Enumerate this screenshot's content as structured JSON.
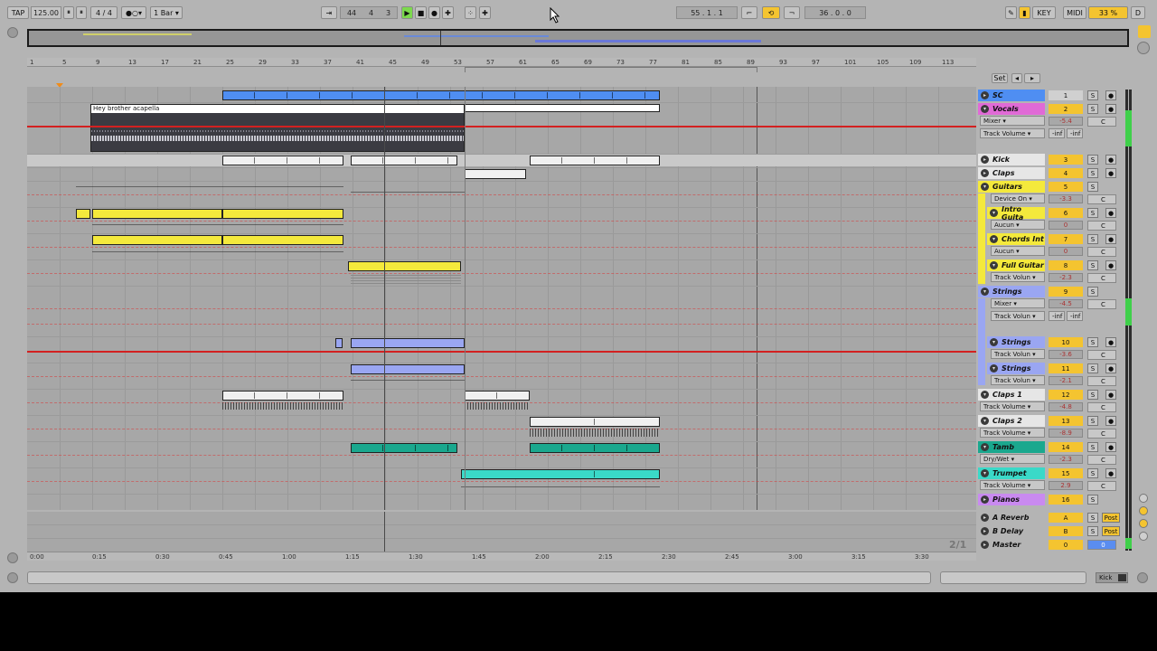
{
  "transport": {
    "tap": "TAP",
    "tempo": "125.00",
    "signature": "4 / 4",
    "quantize": "1 Bar",
    "arr_pos_bar": "44",
    "arr_pos_beat": "4",
    "arr_pos_sixteenth": "3",
    "loop_start": "55 . 1 . 1",
    "loop_length": "36 . 0 . 0",
    "key": "KEY",
    "midi": "MIDI",
    "cpu": "33 %",
    "d": "D"
  },
  "ruler": {
    "bars": [
      "1",
      "5",
      "9",
      "13",
      "17",
      "21",
      "25",
      "29",
      "33",
      "37",
      "41",
      "45",
      "49",
      "53",
      "57",
      "61",
      "65",
      "69",
      "73",
      "77",
      "81",
      "85",
      "89",
      "93",
      "97",
      "101",
      "105",
      "109",
      "113"
    ],
    "times": [
      "0:00",
      "0:15",
      "0:30",
      "0:45",
      "1:00",
      "1:15",
      "1:30",
      "1:45",
      "2:00",
      "2:15",
      "2:30",
      "2:45",
      "3:00",
      "3:15",
      "3:30"
    ]
  },
  "zoom_label": "2/1",
  "clip_names": {
    "vocal": "Hey brother acapella"
  },
  "tracks": [
    {
      "name": "SC",
      "num": "1",
      "color": "#4f8ef2",
      "type": "audio"
    },
    {
      "name": "Vocals",
      "num": "2",
      "color": "#e06ad6",
      "sub1": "Mixer",
      "sub2": "Track Volume",
      "vol": "-5.4",
      "inf1": "-inf",
      "inf2": "-inf",
      "c": "C"
    },
    {
      "name": "Kick",
      "num": "3",
      "color": "#e6e6e6"
    },
    {
      "name": "Claps",
      "num": "4",
      "color": "#e6e6e6"
    },
    {
      "name": "Guitars",
      "num": "5",
      "color": "#f4e93c",
      "sub1": "Device On",
      "vol": "-3.3",
      "c": "C"
    },
    {
      "name": "Intro Guita",
      "num": "6",
      "color": "#f4e93c",
      "sub1": "Aucun",
      "vol": "0",
      "c": "C"
    },
    {
      "name": "Chords Int",
      "num": "7",
      "color": "#f4e93c",
      "sub1": "Aucun",
      "vol": "0",
      "c": "C"
    },
    {
      "name": "Full Guitar",
      "num": "8",
      "color": "#f4e93c",
      "sub1": "Track Volun",
      "vol": "-2.3",
      "c": "C"
    },
    {
      "name": "Strings",
      "num": "9",
      "color": "#9aa6f2",
      "sub1": "Mixer",
      "sub2": "Track Volun",
      "vol": "-4.5",
      "inf1": "-inf",
      "inf2": "-inf",
      "c": "C"
    },
    {
      "name": "Strings",
      "num": "10",
      "color": "#9aa6f2",
      "sub1": "Track Volun",
      "vol": "-3.6",
      "c": "C"
    },
    {
      "name": "Strings",
      "num": "11",
      "color": "#9aa6f2",
      "sub1": "Track Volun",
      "vol": "-2.1",
      "c": "C"
    },
    {
      "name": "Claps 1",
      "num": "12",
      "color": "#e6e6e6",
      "sub1": "Track Volume",
      "vol": "-4.8",
      "c": "C"
    },
    {
      "name": "Claps 2",
      "num": "13",
      "color": "#e6e6e6",
      "sub1": "Track Volume",
      "vol": "-8.9",
      "c": "C"
    },
    {
      "name": "Tamb",
      "num": "14",
      "color": "#1aa88e",
      "sub1": "Dry/Wet",
      "vol": "-2.3",
      "c": "C"
    },
    {
      "name": "Trumpet",
      "num": "15",
      "color": "#3ad9c8",
      "sub1": "Track Volume",
      "vol": "2.9",
      "c": "C"
    },
    {
      "name": "Pianos",
      "num": "16",
      "color": "#c98af0"
    }
  ],
  "returns": [
    {
      "name": "A Reverb",
      "num": "A",
      "post": "Post"
    },
    {
      "name": "B Delay",
      "num": "B",
      "post": "Post"
    },
    {
      "name": "Master",
      "num": "0",
      "master_vol": "0"
    }
  ],
  "solo": "S",
  "bottom": {
    "kick_label": "Kick"
  },
  "set_label": "Set"
}
